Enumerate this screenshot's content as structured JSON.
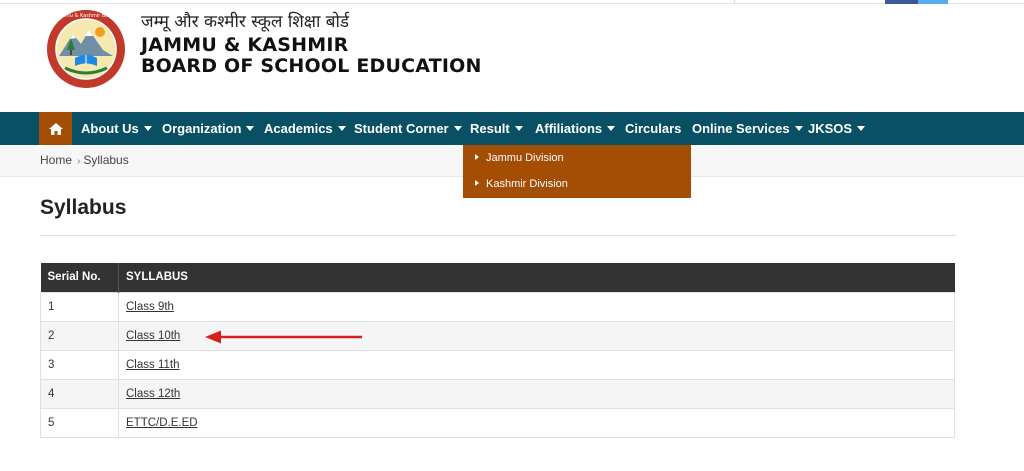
{
  "header": {
    "hindi_title": "जम्मू और कश्मीर स्कूल शिक्षा बोर्ड",
    "title_line1": "JAMMU & KASHMIR",
    "title_line2": "BOARD OF SCHOOL EDUCATION"
  },
  "nav": {
    "home_icon": "home-icon",
    "items": [
      {
        "label": "About Us",
        "has_caret": true
      },
      {
        "label": "Organization",
        "has_caret": true
      },
      {
        "label": "Academics",
        "has_caret": true
      },
      {
        "label": "Student Corner",
        "has_caret": true
      },
      {
        "label": "Result",
        "has_caret": true
      },
      {
        "label": "Affiliations",
        "has_caret": true
      },
      {
        "label": "Circulars",
        "has_caret": false
      },
      {
        "label": "Online Services",
        "has_caret": true
      },
      {
        "label": "JKSOS",
        "has_caret": true
      }
    ]
  },
  "dropdown": {
    "items": [
      "Jammu Division",
      "Kashmir Division"
    ]
  },
  "breadcrumb": {
    "home": "Home",
    "current": "Syllabus"
  },
  "page": {
    "title": "Syllabus"
  },
  "table": {
    "headers": [
      "Serial No.",
      "SYLLABUS"
    ],
    "rows": [
      {
        "serial": "1",
        "syllabus": "Class 9th"
      },
      {
        "serial": "2",
        "syllabus": "Class 10th"
      },
      {
        "serial": "3",
        "syllabus": "Class 11th"
      },
      {
        "serial": "4",
        "syllabus": "Class 12th"
      },
      {
        "serial": "5",
        "syllabus": "ETTC/D.E.ED"
      }
    ]
  },
  "colors": {
    "nav_bg": "#0a5064",
    "accent": "#a34d05",
    "table_header": "#333333",
    "arrow": "#d62020"
  }
}
